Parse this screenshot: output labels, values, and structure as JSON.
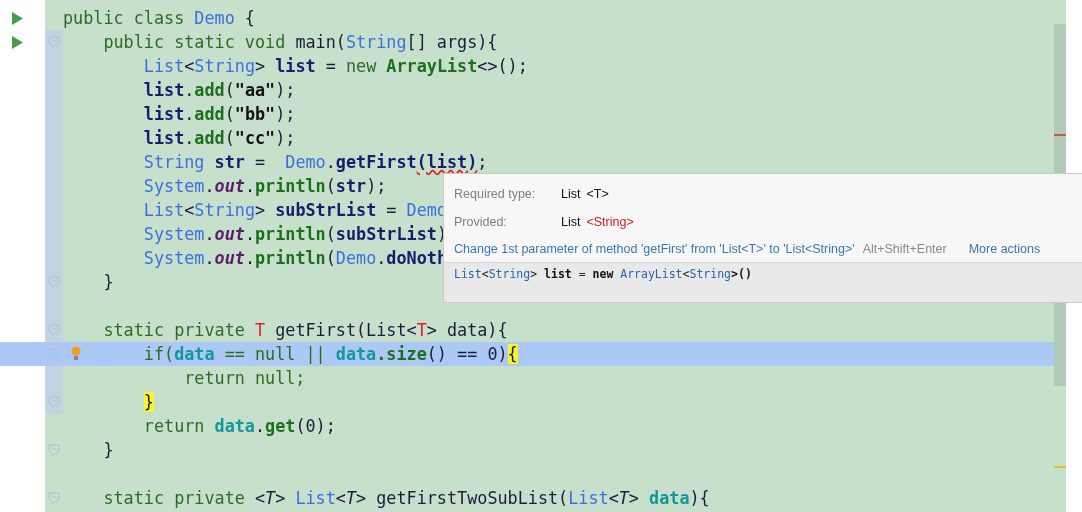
{
  "editor": {
    "lines": [
      {
        "run": true,
        "fold": false,
        "bulb": false,
        "selected": false,
        "tokens": [
          {
            "text": "public class ",
            "kind": "keyword"
          },
          {
            "text": "Demo",
            "kind": "type"
          },
          {
            "text": " {",
            "kind": "plain"
          }
        ]
      },
      {
        "run": true,
        "fold": true,
        "bulb": false,
        "selected": false,
        "tokens": [
          {
            "text": "    public static void ",
            "kind": "keyword"
          },
          {
            "text": "main(",
            "kind": "plain"
          },
          {
            "text": "String",
            "kind": "type"
          },
          {
            "text": "[] args){",
            "kind": "plain"
          }
        ]
      },
      {
        "run": false,
        "fold": false,
        "bulb": false,
        "selected": false,
        "tokens": [
          {
            "text": "        List",
            "kind": "type"
          },
          {
            "text": "<",
            "kind": "plain"
          },
          {
            "text": "String",
            "kind": "type"
          },
          {
            "text": "> ",
            "kind": "plain"
          },
          {
            "text": "list",
            "kind": "local"
          },
          {
            "text": " = ",
            "kind": "plain"
          },
          {
            "text": "new ",
            "kind": "keyword"
          },
          {
            "text": "ArrayList",
            "kind": "class-bold"
          },
          {
            "text": "<>();",
            "kind": "plain"
          }
        ]
      },
      {
        "run": false,
        "fold": false,
        "bulb": false,
        "selected": false,
        "tokens": [
          {
            "text": "        list",
            "kind": "local"
          },
          {
            "text": ".",
            "kind": "plain"
          },
          {
            "text": "add",
            "kind": "method"
          },
          {
            "text": "(",
            "kind": "plain"
          },
          {
            "text": "\"aa\"",
            "kind": "string"
          },
          {
            "text": ");",
            "kind": "plain"
          }
        ]
      },
      {
        "run": false,
        "fold": false,
        "bulb": false,
        "selected": false,
        "tokens": [
          {
            "text": "        list",
            "kind": "local"
          },
          {
            "text": ".",
            "kind": "plain"
          },
          {
            "text": "add",
            "kind": "method"
          },
          {
            "text": "(",
            "kind": "plain"
          },
          {
            "text": "\"bb\"",
            "kind": "string"
          },
          {
            "text": ");",
            "kind": "plain"
          }
        ]
      },
      {
        "run": false,
        "fold": false,
        "bulb": false,
        "selected": false,
        "tokens": [
          {
            "text": "        list",
            "kind": "local"
          },
          {
            "text": ".",
            "kind": "plain"
          },
          {
            "text": "add",
            "kind": "method"
          },
          {
            "text": "(",
            "kind": "plain"
          },
          {
            "text": "\"cc\"",
            "kind": "string"
          },
          {
            "text": ");",
            "kind": "plain"
          }
        ]
      },
      {
        "run": false,
        "fold": false,
        "bulb": false,
        "selected": false,
        "tokens": [
          {
            "text": "        String ",
            "kind": "type"
          },
          {
            "text": "str",
            "kind": "local"
          },
          {
            "text": " =  ",
            "kind": "plain"
          },
          {
            "text": "Demo",
            "kind": "type"
          },
          {
            "text": ".",
            "kind": "plain"
          },
          {
            "text": "getFirst",
            "kind": "local"
          },
          {
            "text": "(list)",
            "kind": "error"
          },
          {
            "text": ";",
            "kind": "plain"
          }
        ]
      },
      {
        "run": false,
        "fold": false,
        "bulb": false,
        "selected": false,
        "tokens": [
          {
            "text": "        System",
            "kind": "type"
          },
          {
            "text": ".",
            "kind": "plain"
          },
          {
            "text": "out",
            "kind": "static-field"
          },
          {
            "text": ".",
            "kind": "plain"
          },
          {
            "text": "println",
            "kind": "method"
          },
          {
            "text": "(",
            "kind": "plain"
          },
          {
            "text": "str",
            "kind": "local"
          },
          {
            "text": ");",
            "kind": "plain"
          }
        ]
      },
      {
        "run": false,
        "fold": false,
        "bulb": false,
        "selected": false,
        "tokens": [
          {
            "text": "        List",
            "kind": "type"
          },
          {
            "text": "<",
            "kind": "plain"
          },
          {
            "text": "String",
            "kind": "type"
          },
          {
            "text": "> ",
            "kind": "plain"
          },
          {
            "text": "subStrList",
            "kind": "local"
          },
          {
            "text": " = ",
            "kind": "plain"
          },
          {
            "text": "Demo",
            "kind": "type"
          }
        ]
      },
      {
        "run": false,
        "fold": false,
        "bulb": false,
        "selected": false,
        "tokens": [
          {
            "text": "        System",
            "kind": "type"
          },
          {
            "text": ".",
            "kind": "plain"
          },
          {
            "text": "out",
            "kind": "static-field"
          },
          {
            "text": ".",
            "kind": "plain"
          },
          {
            "text": "println",
            "kind": "method"
          },
          {
            "text": "(",
            "kind": "plain"
          },
          {
            "text": "subStrList",
            "kind": "local"
          },
          {
            "text": ")",
            "kind": "plain"
          }
        ]
      },
      {
        "run": false,
        "fold": false,
        "bulb": false,
        "selected": false,
        "tokens": [
          {
            "text": "        System",
            "kind": "type"
          },
          {
            "text": ".",
            "kind": "plain"
          },
          {
            "text": "out",
            "kind": "static-field"
          },
          {
            "text": ".",
            "kind": "plain"
          },
          {
            "text": "println",
            "kind": "method"
          },
          {
            "text": "(",
            "kind": "plain"
          },
          {
            "text": "Demo",
            "kind": "type"
          },
          {
            "text": ".",
            "kind": "plain"
          },
          {
            "text": "doNoth",
            "kind": "local"
          }
        ]
      },
      {
        "run": false,
        "fold": true,
        "bulb": false,
        "selected": false,
        "tokens": [
          {
            "text": "    }",
            "kind": "plain"
          }
        ]
      },
      {
        "run": false,
        "fold": false,
        "bulb": false,
        "selected": false
      },
      {
        "run": false,
        "fold": true,
        "bulb": false,
        "selected": false,
        "tokens": [
          {
            "text": "    static private ",
            "kind": "keyword"
          },
          {
            "text": "T",
            "kind": "type-param"
          },
          {
            "text": " getFirst(List<",
            "kind": "plain"
          },
          {
            "text": "T",
            "kind": "type-param"
          },
          {
            "text": "> data){",
            "kind": "plain"
          }
        ]
      },
      {
        "run": false,
        "fold": true,
        "bulb": true,
        "selected": true,
        "tokens": [
          {
            "text": "        if(",
            "kind": "keyword"
          },
          {
            "text": "data",
            "kind": "param"
          },
          {
            "text": " == null || ",
            "kind": "keyword"
          },
          {
            "text": "data",
            "kind": "param"
          },
          {
            "text": ".size",
            "kind": "method"
          },
          {
            "text": "() == 0)",
            "kind": "plain"
          },
          {
            "text": "{",
            "kind": "brace-match"
          }
        ]
      },
      {
        "run": false,
        "fold": false,
        "bulb": false,
        "selected": false,
        "tokens": [
          {
            "text": "            return null;",
            "kind": "keyword"
          }
        ]
      },
      {
        "run": false,
        "fold": true,
        "bulb": false,
        "selected": false,
        "tokens": [
          {
            "text": "        }",
            "kind": "brace-match"
          }
        ]
      },
      {
        "run": false,
        "fold": false,
        "bulb": false,
        "selected": false,
        "tokens": [
          {
            "text": "        return ",
            "kind": "keyword"
          },
          {
            "text": "data",
            "kind": "param"
          },
          {
            "text": ".",
            "kind": "plain"
          },
          {
            "text": "get",
            "kind": "method"
          },
          {
            "text": "(0);",
            "kind": "plain"
          }
        ]
      },
      {
        "run": false,
        "fold": true,
        "bulb": false,
        "selected": false,
        "tokens": [
          {
            "text": "    }",
            "kind": "plain"
          }
        ]
      },
      {
        "run": false,
        "fold": false,
        "bulb": false,
        "selected": false
      },
      {
        "run": false,
        "fold": true,
        "bulb": false,
        "selected": false,
        "tokens": [
          {
            "text": "    static private ",
            "kind": "keyword"
          },
          {
            "text": "<",
            "kind": "plain"
          },
          {
            "text": "T",
            "kind": "type-param-italic"
          },
          {
            "text": "> ",
            "kind": "plain"
          },
          {
            "text": "List",
            "kind": "type"
          },
          {
            "text": "<",
            "kind": "plain"
          },
          {
            "text": "T",
            "kind": "type-param-italic"
          },
          {
            "text": "> getFirstTwoSubList(",
            "kind": "plain"
          },
          {
            "text": "List",
            "kind": "type"
          },
          {
            "text": "<",
            "kind": "plain"
          },
          {
            "text": "T",
            "kind": "type-param-italic"
          },
          {
            "text": "> ",
            "kind": "plain"
          },
          {
            "text": "data",
            "kind": "param"
          },
          {
            "text": "){",
            "kind": "plain"
          }
        ]
      }
    ]
  },
  "popup": {
    "rows": [
      {
        "label": "Required type:",
        "type": "List",
        "generic": "<T>",
        "mismatch": false
      },
      {
        "label": "Provided:",
        "type": "List",
        "generic": "<String>",
        "mismatch": true
      }
    ],
    "fix_action": "Change 1st parameter of method 'getFirst' from 'List<T>' to 'List<String>'",
    "shortcut": "Alt+Shift+Enter",
    "more_actions": "More actions",
    "declaration": [
      {
        "text": "List",
        "kind": "type"
      },
      {
        "text": "<",
        "kind": "plain"
      },
      {
        "text": "String",
        "kind": "type"
      },
      {
        "text": "> ",
        "kind": "plain"
      },
      {
        "text": "list",
        "kind": "local"
      },
      {
        "text": " = ",
        "kind": "plain"
      },
      {
        "text": "new ",
        "kind": "local"
      },
      {
        "text": "ArrayList",
        "kind": "type"
      },
      {
        "text": "<",
        "kind": "plain"
      },
      {
        "text": "String",
        "kind": "type"
      },
      {
        "text": ">()",
        "kind": "local"
      }
    ]
  }
}
